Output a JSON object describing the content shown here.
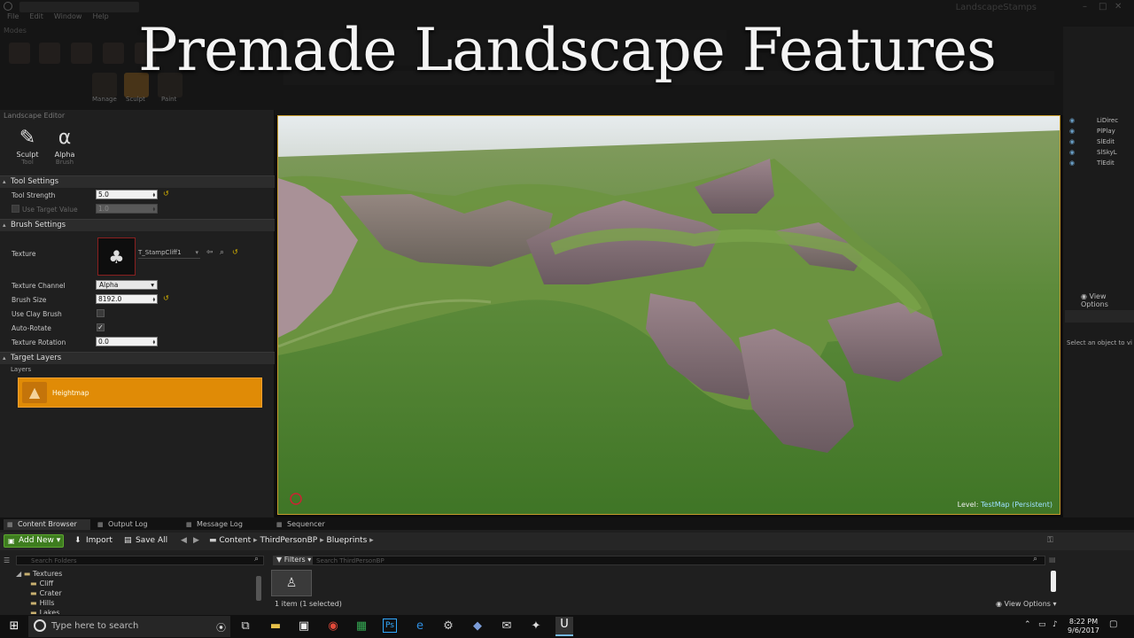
{
  "window": {
    "title": "LandscapeStamps",
    "menu": [
      "File",
      "Edit",
      "Window",
      "Help"
    ]
  },
  "banner": {
    "title": "Premade Landscape Features"
  },
  "modes": {
    "tab": "Modes",
    "mode_labels": [
      "Manage",
      "Sculpt",
      "Paint"
    ]
  },
  "landscape_panel": {
    "title": "Landscape Editor",
    "tools": [
      {
        "label": "Sculpt",
        "sub": "Tool",
        "icon": "brush-icon"
      },
      {
        "label": "Alpha",
        "sub": "Brush",
        "icon": "alpha-brush-icon"
      }
    ],
    "tool_settings": {
      "header": "Tool Settings",
      "tool_strength_label": "Tool Strength",
      "tool_strength": "5.0",
      "use_target_label": "Use Target Value",
      "use_target": "1.0"
    },
    "brush_settings": {
      "header": "Brush Settings",
      "texture_label": "Texture",
      "texture_name": "T_StampCliff1",
      "channel_label": "Texture Channel",
      "channel_value": "Alpha",
      "brush_size_label": "Brush Size",
      "brush_size": "8192.0",
      "use_clay_label": "Use Clay Brush",
      "use_clay_checked": false,
      "auto_rotate_label": "Auto-Rotate",
      "auto_rotate_checked": true,
      "rotation_label": "Texture Rotation",
      "rotation": "0.0"
    },
    "target_layers": {
      "header": "Target Layers",
      "layers_label": "Layers",
      "layer_name": "Heightmap",
      "layer_color": "#e08b06"
    }
  },
  "viewport": {
    "level_label": "Level:",
    "level_name": "TestMap (Persistent)",
    "accent": "#c59a2b"
  },
  "world_outliner": {
    "items": [
      "LiDirec",
      "PlPlay",
      "SlEdit",
      "SlSkyL",
      "TlEdit"
    ],
    "view_options": "View Options",
    "details_hint": "Select an object to vi"
  },
  "bottom": {
    "tabs": [
      "Content Browser",
      "Output Log",
      "Message Log",
      "Sequencer"
    ],
    "add_new": "Add New",
    "import": "Import",
    "save_all": "Save All",
    "breadcrumb": [
      "Content",
      "ThirdPersonBP",
      "Blueprints"
    ],
    "search_folders": "Search Folders",
    "filters": "Filters",
    "search_assets": "Search ThirdPersonBP",
    "folders_root": "Textures",
    "folders": [
      "Cliff",
      "Crater",
      "Hills",
      "Lakes"
    ],
    "status": "1 item (1 selected)",
    "view_options": "View Options"
  },
  "taskbar": {
    "search_placeholder": "Type here to search",
    "time": "8:22 PM",
    "date": "9/6/2017"
  }
}
